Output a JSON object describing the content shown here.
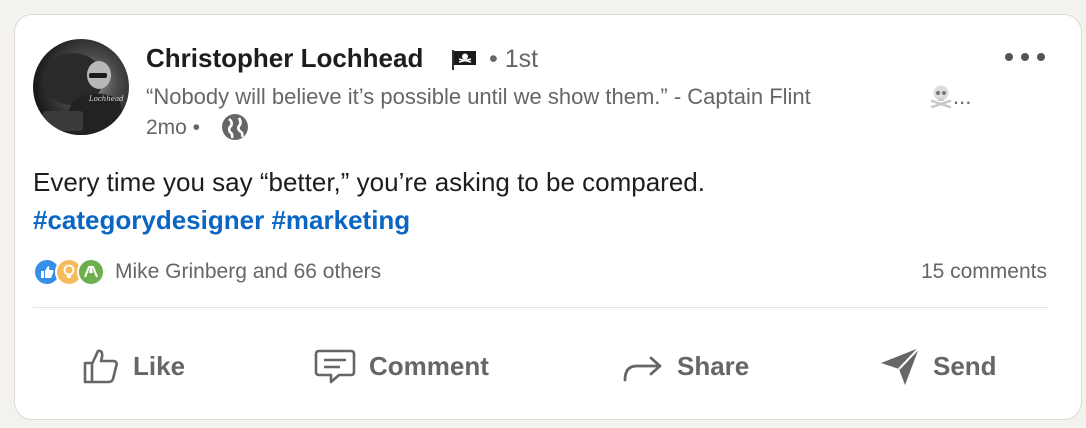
{
  "post": {
    "author_name": "Christopher Lochhead",
    "degree": "• 1st",
    "headline": "“Nobody will believe it’s possible until we show them.” - Captain Flint",
    "headline_ellipsis": "...",
    "time": "2mo •",
    "body": "Every time you say “better,” you’re asking to be compared.",
    "hashtags": [
      "#categorydesigner",
      "#marketing"
    ],
    "reactions_text": "Mike Grinberg and 66 others",
    "comments_text": "15 comments"
  },
  "icons": {
    "name_flag": "pirate-flag-icon",
    "headline_emoji": "skull-crossbones-icon",
    "visibility": "globe-icon",
    "reactions": [
      "like-reaction-icon",
      "insightful-reaction-icon",
      "celebrate-reaction-icon"
    ]
  },
  "actions": {
    "like": "Like",
    "comment": "Comment",
    "share": "Share",
    "send": "Send"
  },
  "colors": {
    "link": "#0a66c2",
    "muted": "#666666",
    "text": "#1d1d1d",
    "like_reaction": "#378fe9",
    "insightful_reaction": "#f5bb5c",
    "celebrate_reaction": "#6dae4f"
  }
}
